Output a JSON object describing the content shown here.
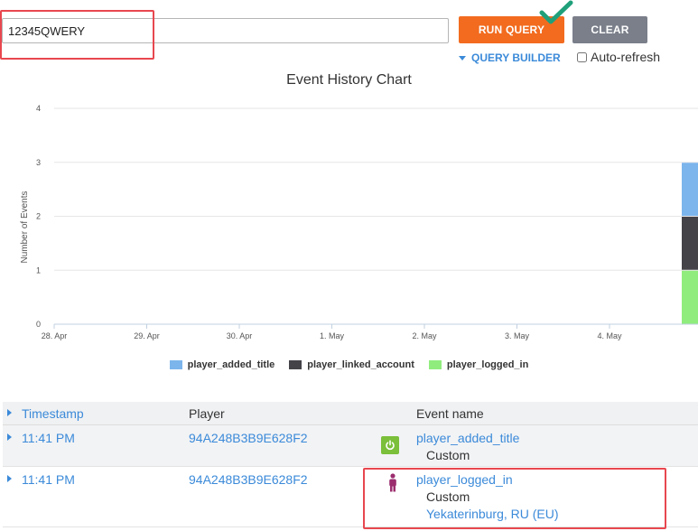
{
  "query": {
    "value": "12345QWERY"
  },
  "toolbar": {
    "run_label": "RUN QUERY",
    "clear_label": "CLEAR",
    "query_builder_label": "QUERY BUILDER",
    "auto_refresh_label": "Auto-refresh",
    "auto_refresh_checked": false
  },
  "colors": {
    "accent": "#3b8ad9",
    "run_button": "#f26b1f",
    "clear_button": "#7a7f8a",
    "highlight": "#e8474f",
    "checkmark": "#1fa07a"
  },
  "chart_data": {
    "type": "bar",
    "title": "Event History Chart",
    "ylabel": "Number of Events",
    "xlabel": "",
    "x_ticks": [
      "28. Apr",
      "29. Apr",
      "30. Apr",
      "1. May",
      "2. May",
      "3. May",
      "4. May"
    ],
    "ylim": [
      0,
      4
    ],
    "y_ticks": [
      "0",
      "1",
      "2",
      "3",
      "4"
    ],
    "stacked": true,
    "grid": true,
    "legend_position": "bottom",
    "series": [
      {
        "name": "player_added_title",
        "color": "#7cb5ec",
        "values": [
          0,
          0,
          0,
          0,
          0,
          0,
          0,
          1
        ]
      },
      {
        "name": "player_linked_account",
        "color": "#434348",
        "values": [
          0,
          0,
          0,
          0,
          0,
          0,
          0,
          1
        ]
      },
      {
        "name": "player_logged_in",
        "color": "#90ed7d",
        "values": [
          0,
          0,
          0,
          0,
          0,
          0,
          0,
          1
        ]
      }
    ]
  },
  "table": {
    "headers": {
      "timestamp": "Timestamp",
      "player": "Player",
      "event_name": "Event name"
    },
    "rows": [
      {
        "time": "11:41 PM",
        "player": "94A248B3B9E628F2",
        "event": "player_added_title",
        "type": "Custom",
        "icon": "power-icon",
        "location": ""
      },
      {
        "time": "11:41 PM",
        "player": "94A248B3B9E628F2",
        "event": "player_logged_in",
        "type": "Custom",
        "icon": "person-icon",
        "location": "Yekaterinburg, RU (EU)"
      }
    ]
  }
}
